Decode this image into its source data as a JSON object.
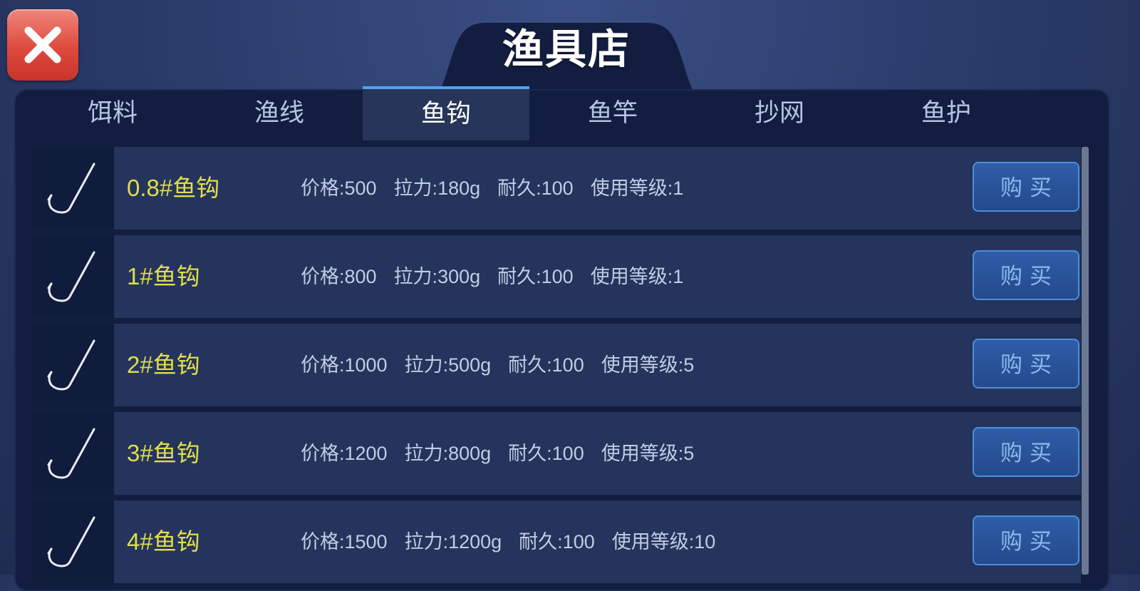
{
  "title": "渔具店",
  "tabs": [
    {
      "label": "饵料",
      "active": false
    },
    {
      "label": "渔线",
      "active": false
    },
    {
      "label": "鱼钩",
      "active": true
    },
    {
      "label": "鱼竿",
      "active": false
    },
    {
      "label": "抄网",
      "active": false
    },
    {
      "label": "鱼护",
      "active": false
    }
  ],
  "items": [
    {
      "name": "0.8#鱼钩",
      "price": "价格:500",
      "tension": "拉力:180g",
      "durability": "耐久:100",
      "level": "使用等级:1",
      "buy_label": "购买",
      "icon": "fish-hook-icon"
    },
    {
      "name": "1#鱼钩",
      "price": "价格:800",
      "tension": "拉力:300g",
      "durability": "耐久:100",
      "level": "使用等级:1",
      "buy_label": "购买",
      "icon": "fish-hook-icon"
    },
    {
      "name": "2#鱼钩",
      "price": "价格:1000",
      "tension": "拉力:500g",
      "durability": "耐久:100",
      "level": "使用等级:5",
      "buy_label": "购买",
      "icon": "fish-hook-icon"
    },
    {
      "name": "3#鱼钩",
      "price": "价格:1200",
      "tension": "拉力:800g",
      "durability": "耐久:100",
      "level": "使用等级:5",
      "buy_label": "购买",
      "icon": "fish-hook-icon"
    },
    {
      "name": "4#鱼钩",
      "price": "价格:1500",
      "tension": "拉力:1200g",
      "durability": "耐久:100",
      "level": "使用等级:10",
      "buy_label": "购买",
      "icon": "fish-hook-icon"
    }
  ],
  "close_icon": "close-icon",
  "colors": {
    "item_name": "#e1dd4c",
    "active_tab_indicator": "#4fa4ee",
    "close_button": "#de4a3e",
    "buy_button_border": "#4b8fe0"
  }
}
